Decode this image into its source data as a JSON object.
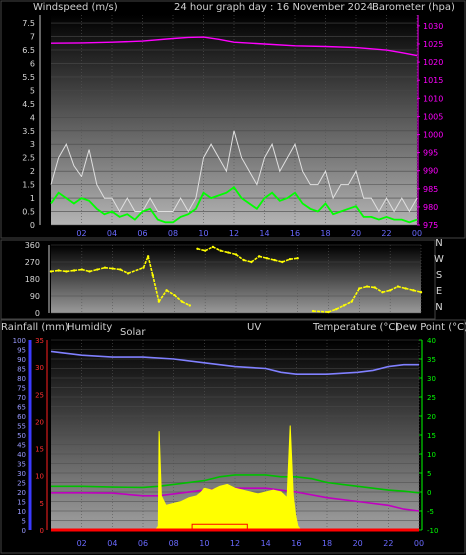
{
  "header": {
    "windspeed_label": "Windspeed (m/s)",
    "title": "24 hour graph day : 16 November 2024",
    "barometer_label": "Barometer (hpa)"
  },
  "compass": [
    "N",
    "W",
    "S",
    "E",
    "N"
  ],
  "lower_header": {
    "rainfall_label": "Rainfall (mm)",
    "humidity_label": "Humidity",
    "solar_label": "Solar",
    "uv_label": "UV",
    "temperature_label": "Temperature (°C)",
    "dewpoint_label": "Dew Point (°C)"
  },
  "colors": {
    "wind_gust": "#e0e0e0",
    "wind_avg": "#00ff00",
    "barometer": "#ff00ff",
    "direction": "#ffff00",
    "humidity": "#8080ff",
    "temperature": "#00c000",
    "dewpoint": "#c000c0",
    "solar": "#ffff00",
    "uv": "#ff0000",
    "rain": "#ff0000",
    "rain_axis": "#3a3aff",
    "temp_axis": "#00ff00"
  },
  "chart_data": [
    {
      "type": "line",
      "name": "wind-barometer",
      "x_ticks": [
        "02",
        "04",
        "06",
        "08",
        "10",
        "12",
        "14",
        "16",
        "18",
        "20",
        "22",
        "00"
      ],
      "y_left_ticks": [
        "0",
        "0.5",
        "1",
        "1.5",
        "2",
        "2.5",
        "3",
        "3.5",
        "4",
        "4.5",
        "5",
        "5.5",
        "6",
        "6.5",
        "7",
        "7.5"
      ],
      "y_right_ticks": [
        "975",
        "980",
        "985",
        "990",
        "995",
        "1000",
        "1005",
        "1010",
        "1015",
        "1020",
        "1025",
        "1030"
      ],
      "ylim_left": [
        0,
        7.8
      ],
      "ylim_right": [
        975,
        1033
      ],
      "xlim": [
        0,
        24
      ],
      "series": [
        {
          "role": "barometer",
          "axis": "right",
          "x": [
            0,
            2,
            4,
            6,
            8,
            9,
            10,
            11,
            12,
            14,
            16,
            18,
            20,
            22,
            23,
            24
          ],
          "y": [
            1025.2,
            1025.3,
            1025.5,
            1025.8,
            1026.5,
            1026.8,
            1026.9,
            1026.3,
            1025.5,
            1025.0,
            1024.5,
            1024.3,
            1024.0,
            1023.3,
            1022.6,
            1021.8
          ]
        },
        {
          "role": "gust",
          "axis": "left",
          "x": [
            0,
            0.5,
            1,
            1.5,
            2,
            2.5,
            3,
            3.5,
            4,
            4.5,
            5,
            5.5,
            6,
            6.5,
            7,
            7.5,
            8,
            8.5,
            9,
            9.5,
            10,
            10.5,
            11,
            11.5,
            12,
            12.5,
            13,
            13.5,
            14,
            14.5,
            15,
            15.5,
            16,
            16.5,
            17,
            17.5,
            18,
            18.5,
            19,
            19.5,
            20,
            20.5,
            21,
            21.5,
            22,
            22.5,
            23,
            23.5,
            24
          ],
          "y": [
            1.5,
            2.5,
            3.0,
            2.2,
            1.8,
            2.8,
            1.5,
            1.0,
            1.0,
            0.5,
            1.0,
            0.5,
            0.5,
            1.0,
            0.5,
            0.5,
            0.5,
            1.0,
            0.5,
            1.0,
            2.5,
            3.0,
            2.5,
            2.0,
            3.5,
            2.5,
            2.0,
            1.5,
            2.5,
            3.0,
            2.0,
            2.5,
            3.0,
            2.0,
            1.5,
            1.5,
            2.0,
            1.0,
            1.5,
            1.5,
            2.0,
            1.0,
            1.0,
            0.5,
            1.0,
            0.5,
            1.0,
            0.5,
            1.0
          ]
        },
        {
          "role": "average",
          "axis": "left",
          "x": [
            0,
            0.5,
            1,
            1.5,
            2,
            2.5,
            3,
            3.5,
            4,
            4.5,
            5,
            5.5,
            6,
            6.5,
            7,
            7.5,
            8,
            8.5,
            9,
            9.5,
            10,
            10.5,
            11,
            11.5,
            12,
            12.5,
            13,
            13.5,
            14,
            14.5,
            15,
            15.5,
            16,
            16.5,
            17,
            17.5,
            18,
            18.5,
            19,
            19.5,
            20,
            20.5,
            21,
            21.5,
            22,
            22.5,
            23,
            23.5,
            24
          ],
          "y": [
            0.8,
            1.2,
            1.0,
            0.8,
            1.0,
            0.9,
            0.6,
            0.4,
            0.5,
            0.3,
            0.4,
            0.2,
            0.5,
            0.6,
            0.2,
            0.1,
            0.1,
            0.3,
            0.4,
            0.6,
            1.2,
            1.0,
            1.1,
            1.2,
            1.4,
            1.0,
            0.8,
            0.6,
            1.0,
            1.2,
            0.9,
            1.0,
            1.2,
            0.8,
            0.6,
            0.5,
            0.8,
            0.4,
            0.5,
            0.6,
            0.7,
            0.3,
            0.3,
            0.2,
            0.3,
            0.2,
            0.2,
            0.1,
            0.2
          ]
        }
      ]
    },
    {
      "type": "scatter",
      "name": "wind-direction",
      "y_ticks": [
        "0",
        "90",
        "180",
        "270",
        "360"
      ],
      "ylim": [
        0,
        360
      ],
      "xlim": [
        0,
        24
      ],
      "series": [
        {
          "role": "direction",
          "x": [
            0,
            0.5,
            1,
            1.5,
            2,
            2.5,
            3,
            3.5,
            4,
            4.5,
            5,
            6.0,
            6.3,
            6.6,
            7,
            7.5,
            8,
            8.5,
            9,
            9.5,
            10,
            10.5,
            11,
            11.5,
            12,
            12.5,
            13,
            13.5,
            14,
            14.5,
            15,
            15.5,
            16,
            17,
            18,
            18.5,
            19,
            19.5,
            20,
            20.5,
            21,
            21.5,
            22,
            22.5,
            23,
            23.5,
            24
          ],
          "y": [
            220,
            225,
            220,
            225,
            230,
            220,
            230,
            240,
            235,
            230,
            210,
            240,
            300,
            200,
            60,
            120,
            95,
            60,
            40,
            340,
            330,
            350,
            330,
            320,
            310,
            280,
            270,
            300,
            290,
            280,
            270,
            285,
            290,
            10,
            5,
            20,
            40,
            60,
            130,
            140,
            135,
            110,
            120,
            140,
            130,
            120,
            110
          ]
        }
      ]
    },
    {
      "type": "line",
      "name": "temperature-humidity-solar",
      "x_ticks": [
        "02",
        "04",
        "06",
        "08",
        "10",
        "12",
        "14",
        "16",
        "18",
        "20",
        "22",
        "00"
      ],
      "y_left_ticks": [
        "0",
        "5",
        "10",
        "15",
        "20",
        "25",
        "30",
        "35",
        "40",
        "45",
        "50",
        "55",
        "60",
        "65",
        "70",
        "75",
        "80",
        "85",
        "90",
        "95",
        "100"
      ],
      "y_rain_ticks": [
        "0",
        "5",
        "10",
        "15",
        "20",
        "25",
        "30",
        "35"
      ],
      "y_right_ticks": [
        "-10",
        "-5",
        "0",
        "5",
        "10",
        "15",
        "20",
        "25",
        "30",
        "35",
        "40"
      ],
      "ylim_left": [
        0,
        100
      ],
      "ylim_rain": [
        0,
        35
      ],
      "ylim_right": [
        -10,
        40
      ],
      "xlim": [
        0,
        24
      ],
      "series": [
        {
          "role": "humidity",
          "axis": "left",
          "x": [
            0,
            1,
            2,
            4,
            6,
            8,
            10,
            12,
            14,
            15,
            16,
            18,
            20,
            21,
            22,
            23,
            24
          ],
          "y": [
            94,
            93,
            92,
            91,
            91,
            90,
            88,
            86,
            85,
            83,
            82,
            82,
            83,
            84,
            86,
            87,
            87
          ]
        },
        {
          "role": "temperature",
          "axis": "right",
          "x": [
            0,
            2,
            4,
            6,
            7,
            8,
            10,
            11,
            12,
            13,
            14,
            15,
            16,
            17,
            18,
            19,
            20,
            21,
            22,
            23,
            24
          ],
          "y": [
            1.5,
            1.5,
            1.3,
            1.2,
            1.5,
            2.0,
            3.0,
            4.0,
            4.5,
            4.5,
            4.5,
            4.0,
            4.0,
            3.5,
            2.5,
            2.0,
            1.5,
            1.0,
            0.5,
            0.2,
            -0.2
          ]
        },
        {
          "role": "dewpoint",
          "axis": "right",
          "x": [
            0,
            2,
            4,
            6,
            7,
            8,
            10,
            12,
            14,
            16,
            18,
            20,
            22,
            23,
            24
          ],
          "y": [
            -0.2,
            -0.2,
            -0.3,
            -1.0,
            -1.0,
            -0.5,
            0.5,
            1.0,
            1.0,
            0.0,
            -1.5,
            -2.5,
            -3.5,
            -4.5,
            -5.0
          ]
        },
        {
          "role": "solar",
          "axis": "left",
          "x": [
            6.8,
            7.0,
            7.05,
            7.2,
            7.5,
            8.0,
            8.5,
            9.0,
            9.5,
            9.8,
            10.0,
            10.5,
            11.0,
            11.5,
            12.0,
            12.5,
            13.0,
            13.5,
            14.0,
            14.5,
            15.0,
            15.4,
            15.6,
            15.8,
            15.95,
            16.1,
            16.3
          ],
          "y": [
            0,
            2,
            52,
            18,
            13,
            14,
            15,
            17,
            18,
            20,
            22,
            21,
            23,
            24,
            22,
            21,
            20,
            19,
            20,
            21,
            20,
            17,
            55,
            18,
            8,
            2,
            0
          ]
        },
        {
          "role": "uv",
          "axis": "left",
          "x": [
            9.2,
            9.2,
            12.8,
            12.8
          ],
          "y": [
            0,
            3,
            3,
            0
          ]
        },
        {
          "role": "rain",
          "axis": "rain",
          "x": [
            0,
            24
          ],
          "y": [
            0,
            0
          ]
        }
      ]
    }
  ]
}
